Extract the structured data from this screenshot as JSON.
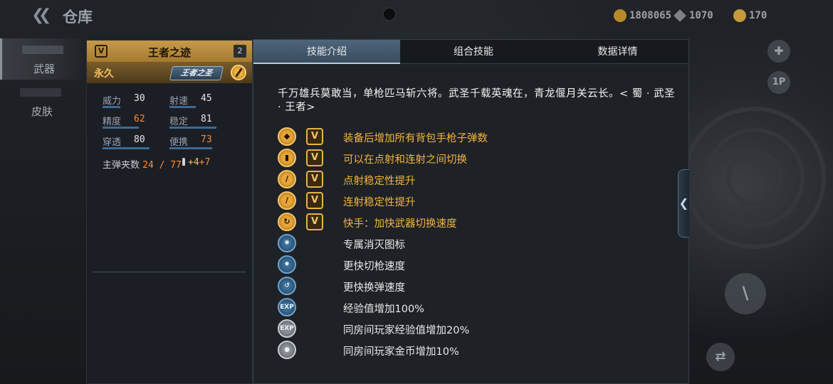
{
  "topbar": {
    "title": "仓库",
    "currencies": [
      {
        "icon": "gold-coin-icon",
        "value": "1808065"
      },
      {
        "icon": "diamond-icon",
        "value": "1070"
      },
      {
        "icon": "token-icon",
        "value": "170"
      }
    ]
  },
  "nav": {
    "items": [
      {
        "label": "武器",
        "active": true
      },
      {
        "label": "皮肤",
        "active": false
      }
    ]
  },
  "weapon": {
    "name": "王者之迹",
    "rank_badge": "V",
    "count": "2",
    "duration": "永久",
    "tag": "王者之圣",
    "stats": [
      {
        "label": "威力",
        "value": "30",
        "highlight": false,
        "fill": 0.3
      },
      {
        "label": "射速",
        "value": "45",
        "highlight": false,
        "fill": 0.45
      },
      {
        "label": "精度",
        "value": "62",
        "highlight": true,
        "fill": 0.62
      },
      {
        "label": "稳定",
        "value": "81",
        "highlight": false,
        "fill": 0.81
      },
      {
        "label": "穿透",
        "value": "80",
        "highlight": false,
        "fill": 0.8
      },
      {
        "label": "便携",
        "value": "73",
        "highlight": true,
        "fill": 0.73
      }
    ],
    "ammo_label": "主弹夹数",
    "ammo_value": "24 / 77",
    "ammo_bonus_1": "+4",
    "ammo_bonus_2": "+7"
  },
  "tabs": [
    {
      "label": "技能介绍",
      "active": true
    },
    {
      "label": "组合技能",
      "active": false
    },
    {
      "label": "数据详情",
      "active": false
    }
  ],
  "description": "千万雄兵莫敢当，单枪匹马斩六将。武圣千载英魂在，青龙偃月关云长。< 蜀 · 武圣 · 王者>",
  "skills": [
    {
      "text": "装备后增加所有背包手枪子弹数",
      "tier": "gold",
      "badge": "V",
      "icon": "pistol-icon"
    },
    {
      "text": "可以在点射和连射之间切换",
      "tier": "gold",
      "badge": "V",
      "icon": "fire-mode-icon"
    },
    {
      "text": "点射稳定性提升",
      "tier": "gold",
      "badge": "V",
      "icon": "single-shot-icon"
    },
    {
      "text": "连射稳定性提升",
      "tier": "gold",
      "badge": "V",
      "icon": "burst-shot-icon"
    },
    {
      "text": "快手：加快武器切换速度",
      "tier": "gold",
      "badge": "V",
      "icon": "quick-hand-icon"
    },
    {
      "text": "专属消灭图标",
      "tier": "blue",
      "badge": "",
      "icon": "kill-mark-icon"
    },
    {
      "text": "更快切枪速度",
      "tier": "blue",
      "badge": "",
      "icon": "swap-speed-icon"
    },
    {
      "text": "更快换弹速度",
      "tier": "blue",
      "badge": "",
      "icon": "reload-speed-icon"
    },
    {
      "text": "经验值增加100%",
      "tier": "blue",
      "badge": "",
      "icon": "exp-icon"
    },
    {
      "text": "同房间玩家经验值增加20%",
      "tier": "gray",
      "badge": "",
      "icon": "room-exp-icon"
    },
    {
      "text": "同房间玩家金币增加10%",
      "tier": "gray",
      "badge": "",
      "icon": "room-coin-icon"
    }
  ],
  "side_buttons": {
    "view_label": "1P"
  }
}
